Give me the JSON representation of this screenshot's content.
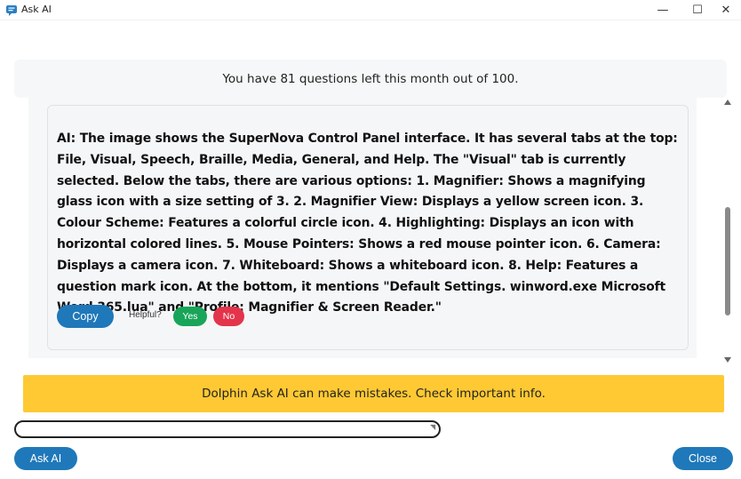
{
  "window": {
    "title": "Ask AI",
    "minimize_glyph": "—",
    "maximize_glyph": "☐",
    "close_glyph": "✕"
  },
  "quota": {
    "text": "You have 81 questions left this month out of 100."
  },
  "answer": {
    "prefix": "AI:",
    "text": " The image shows the SuperNova Control Panel interface. It has several tabs at the top: File, Visual, Speech, Braille, Media, General, and Help. The \"Visual\" tab is currently selected. Below the tabs, there are various options: 1. Magnifier: Shows a magnifying glass icon with a size setting of 3. 2. Magnifier View: Displays a yellow screen icon. 3. Colour Scheme: Features a colorful circle icon. 4. Highlighting: Displays an icon with horizontal colored lines. 5. Mouse Pointers: Shows a red mouse pointer icon. 6. Camera: Displays a camera icon. 7. Whiteboard: Shows a whiteboard icon. 8. Help: Features a question mark icon. At the bottom, it mentions \"Default Settings. winword.exe Microsoft Word 365.lua\" and \"Profile: Magnifier & Screen Reader.\"",
    "copy_label": "Copy",
    "helpful_label": "Helpful?",
    "yes_label": "Yes",
    "no_label": "No"
  },
  "warning": {
    "text": "Dolphin Ask AI can make mistakes. Check important info."
  },
  "input": {
    "value": "",
    "placeholder": ""
  },
  "buttons": {
    "ask_ai": "Ask AI",
    "close": "Close"
  },
  "colors": {
    "primary_button": "#1f78b9",
    "yes_button": "#18a559",
    "no_button": "#e3344b",
    "warning_bg": "#ffc933",
    "panel_bg": "#f6f7f8"
  },
  "icons": {
    "app": "chat-bubble-icon",
    "minimize": "minimize-icon",
    "maximize": "maximize-icon",
    "close": "close-icon"
  }
}
